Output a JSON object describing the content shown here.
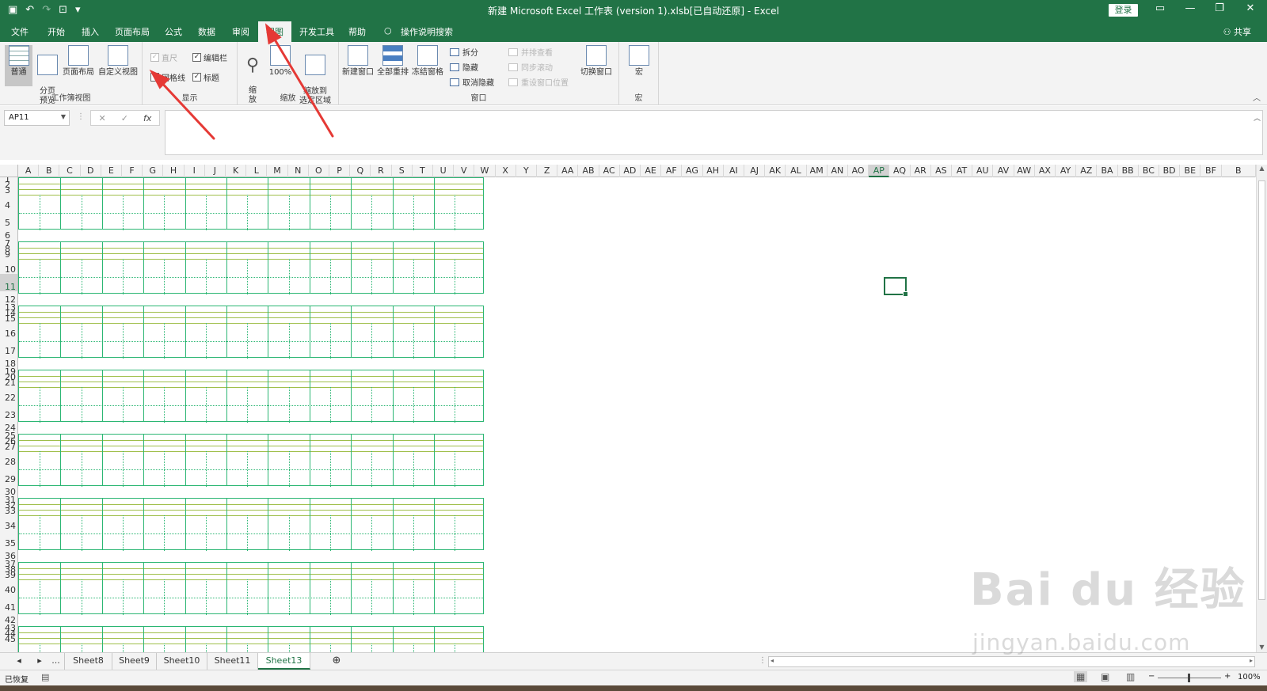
{
  "window": {
    "title": "新建 Microsoft Excel 工作表 (version 1).xlsb[已自动还原]  -  Excel",
    "login_label": "登录",
    "minimize": "—",
    "restore": "❐",
    "close": "✕"
  },
  "qat": {
    "save_icon": "save-icon",
    "undo": "↶",
    "redo": "↷",
    "more": "▾"
  },
  "tabs": [
    "文件",
    "开始",
    "插入",
    "页面布局",
    "公式",
    "数据",
    "审阅",
    "视图",
    "开发工具",
    "帮助"
  ],
  "active_tab": "视图",
  "search_tab": "操作说明搜索",
  "share_label": "共享",
  "ribbon": {
    "workbook_views": {
      "label": "工作簿视图",
      "normal": "普通",
      "page_break": "分页\n预览",
      "page_layout": "页面布局",
      "custom_views": "自定义视图"
    },
    "show": {
      "label": "显示",
      "ruler": "直尺",
      "formula_bar": "编辑栏",
      "gridlines": "网格线",
      "headings": "标题"
    },
    "zoom": {
      "label": "缩放",
      "zoom": "缩\n放",
      "zoom100": "100%",
      "zoom_selection": "缩放到\n选定区域"
    },
    "window": {
      "label": "窗口",
      "new_window": "新建窗口",
      "arrange_all": "全部重排",
      "freeze_panes": "冻结窗格",
      "split": "拆分",
      "hide": "隐藏",
      "unhide": "取消隐藏",
      "side_by_side": "并排查看",
      "sync_scroll": "同步滚动",
      "reset_position": "重设窗口位置",
      "switch_windows": "切换窗口"
    },
    "macros": {
      "label": "宏",
      "macros": "宏"
    }
  },
  "formula_bar": {
    "name_box": "AP11",
    "cancel": "✕",
    "enter": "✓",
    "fx": "fx",
    "value": ""
  },
  "columns": [
    "A",
    "B",
    "C",
    "D",
    "E",
    "F",
    "G",
    "H",
    "I",
    "J",
    "K",
    "L",
    "M",
    "N",
    "O",
    "P",
    "Q",
    "R",
    "S",
    "T",
    "U",
    "V",
    "W",
    "X",
    "Y",
    "Z",
    "AA",
    "AB",
    "AC",
    "AD",
    "AE",
    "AF",
    "AG",
    "AH",
    "AI",
    "AJ",
    "AK",
    "AL",
    "AM",
    "AN",
    "AO",
    "AP",
    "AQ",
    "AR",
    "AS",
    "AT",
    "AU",
    "AV",
    "AW",
    "AX",
    "AY",
    "AZ",
    "BA",
    "BB",
    "BC",
    "BD",
    "BE",
    "BF",
    "B"
  ],
  "active_column": "AP",
  "rows": [
    "1",
    "2",
    "3",
    "4",
    "5",
    "6",
    "7",
    "8",
    "9",
    "10",
    "11",
    "12",
    "13",
    "14",
    "15",
    "16",
    "17",
    "18",
    "19",
    "20",
    "21",
    "22",
    "23",
    "24",
    "25",
    "26",
    "27",
    "28",
    "29",
    "30",
    "31",
    "32",
    "33",
    "34",
    "35",
    "36",
    "37",
    "38",
    "39",
    "40",
    "41",
    "42",
    "43",
    "44",
    "45"
  ],
  "active_row": "11",
  "sheet_tabs": [
    "...",
    "Sheet8",
    "Sheet9",
    "Sheet10",
    "Sheet11",
    "Sheet13"
  ],
  "active_sheet": "Sheet13",
  "add_sheet": "⊕",
  "status": {
    "left": "已恢复",
    "zoom_level": "100%",
    "zoom_minus": "−",
    "zoom_plus": "+"
  },
  "watermark": {
    "brand": "Bai du 经验",
    "url": "jingyan.baidu.com"
  },
  "colors": {
    "excel_green": "#217346",
    "grid_green": "#2bb673",
    "arrow_red": "#e53935"
  }
}
